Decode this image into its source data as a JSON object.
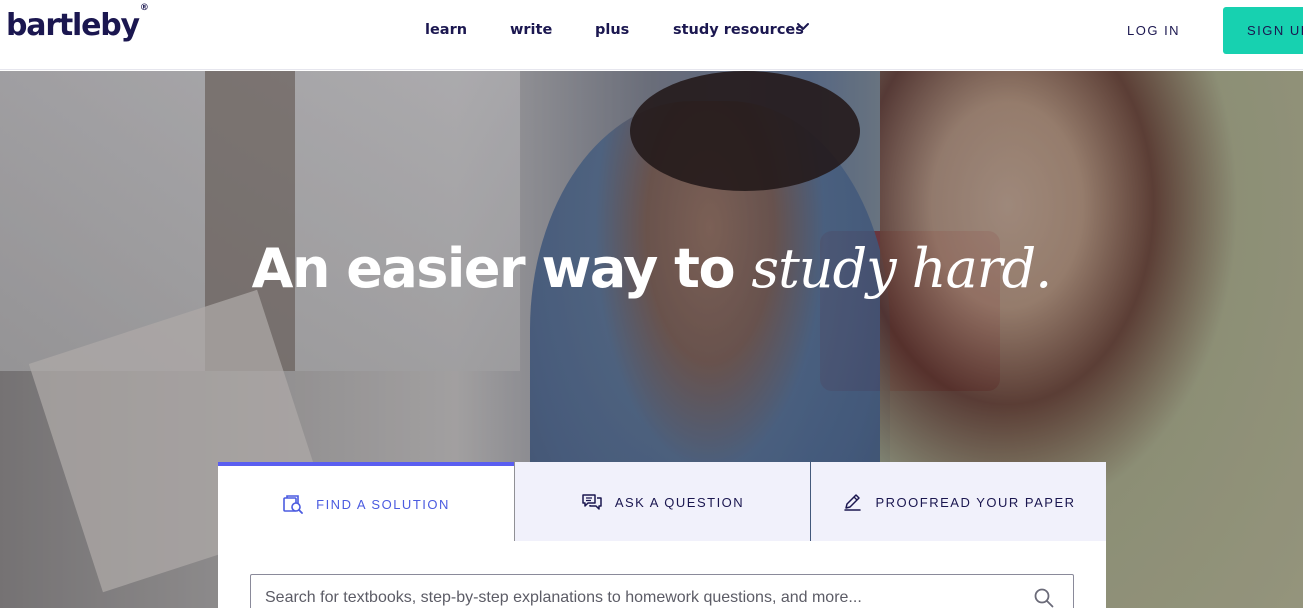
{
  "header": {
    "logo": "bartleby",
    "logo_mark": "®",
    "nav": [
      {
        "label": "learn"
      },
      {
        "label": "write"
      },
      {
        "label": "plus"
      },
      {
        "label": "study resources"
      }
    ],
    "login_label": "LOG IN",
    "signup_label": "SIGN UP"
  },
  "hero": {
    "headline_plain": "An easier way to",
    "headline_italic": "study hard."
  },
  "tabs": [
    {
      "label": "FIND A SOLUTION",
      "icon": "find-solution-icon",
      "active": true
    },
    {
      "label": "ASK A QUESTION",
      "icon": "chat-bubbles-icon",
      "active": false
    },
    {
      "label": "PROOFREAD YOUR PAPER",
      "icon": "pencil-icon",
      "active": false
    }
  ],
  "search": {
    "placeholder": "Search for textbooks, step-by-step explanations to homework questions, and more..."
  },
  "colors": {
    "brand_navy": "#1b1750",
    "signup_teal": "#17d1b0",
    "active_tab_accent": "#5a5ef0",
    "inactive_tab_bg": "#f1f1fb"
  }
}
